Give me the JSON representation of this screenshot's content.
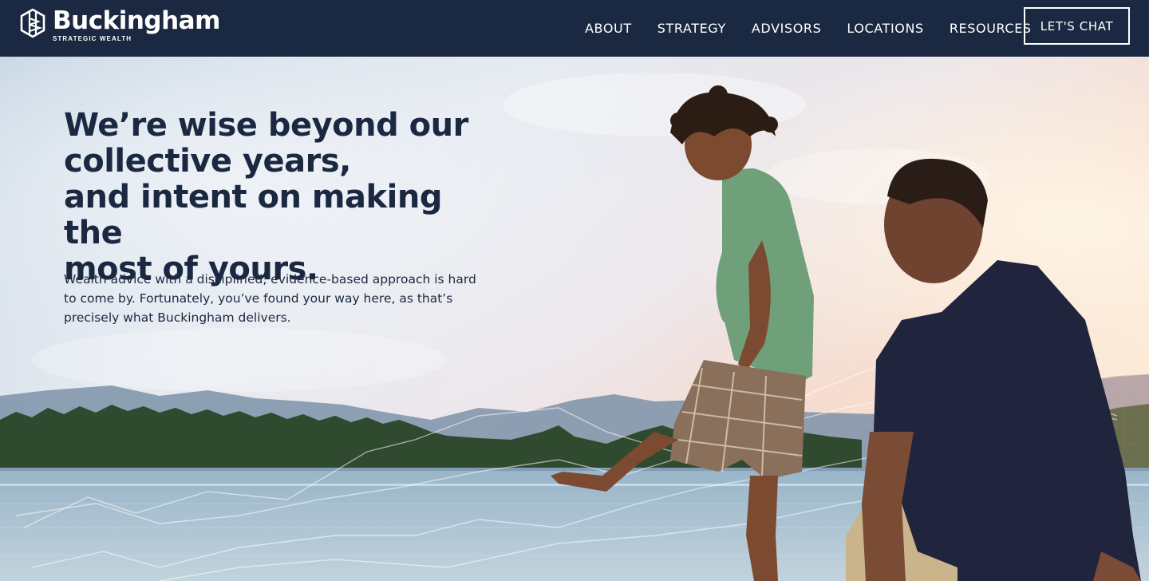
{
  "brand": {
    "name": "Buckingham",
    "tagline": "STRATEGIC WEALTH"
  },
  "nav": {
    "items": [
      {
        "label": "ABOUT"
      },
      {
        "label": "STRATEGY"
      },
      {
        "label": "ADVISORS"
      },
      {
        "label": "LOCATIONS"
      },
      {
        "label": "RESOURCES"
      }
    ],
    "cta_label": "LET'S CHAT"
  },
  "hero": {
    "headline_lines": [
      "We’re wise beyond our",
      "collective years,",
      "and intent on making the",
      "most of yours."
    ],
    "body": "Wealth advice with a disciplined, evidence-based approach is hard to come by. Fortunately, you’ve found your way here, as that’s precisely what Buckingham delivers."
  },
  "colors": {
    "header_bg": "#1b2841",
    "text_dark": "#1b2841",
    "white": "#ffffff"
  },
  "icons": {
    "logo": "buckingham-hexagon-mark-icon"
  }
}
